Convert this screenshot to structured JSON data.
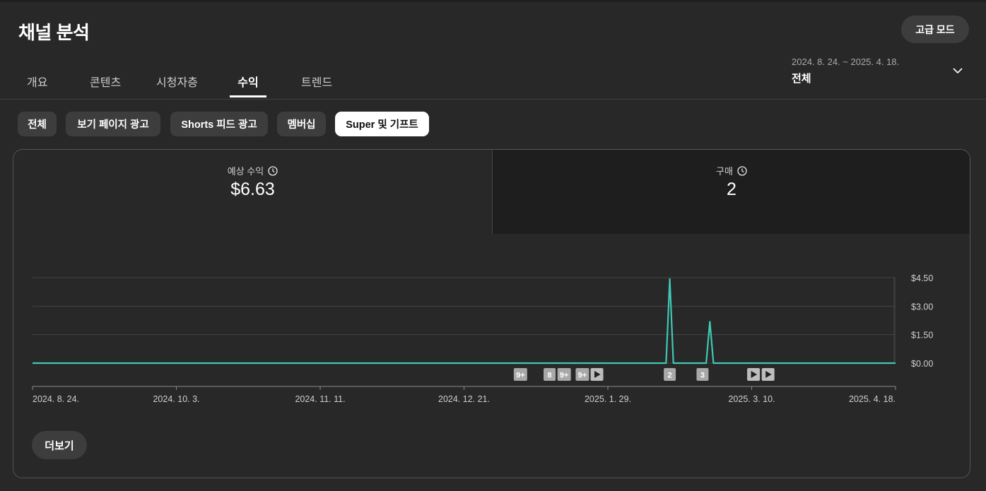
{
  "app": {
    "title": "채널 분석",
    "advanced_mode_label": "고급 모드"
  },
  "tabs": [
    {
      "label": "개요",
      "active": false
    },
    {
      "label": "콘텐츠",
      "active": false
    },
    {
      "label": "시청자층",
      "active": false
    },
    {
      "label": "수익",
      "active": true
    },
    {
      "label": "트렌드",
      "active": false
    }
  ],
  "date_picker": {
    "range": "2024. 8. 24. ~ 2025. 4. 18.",
    "period": "전체",
    "icon": "chevron-down-icon"
  },
  "filter_chips": [
    {
      "label": "전체",
      "selected": false
    },
    {
      "label": "보기 페이지 광고",
      "selected": false
    },
    {
      "label": "Shorts 피드 광고",
      "selected": false
    },
    {
      "label": "멤버십",
      "selected": false
    },
    {
      "label": "Super 및 기프트",
      "selected": true
    }
  ],
  "metrics": [
    {
      "label": "예상 수익",
      "value": "$6.63",
      "icon": "clock-icon",
      "selected": true
    },
    {
      "label": "구매",
      "value": "2",
      "icon": "clock-icon",
      "selected": false
    }
  ],
  "chart_data": {
    "type": "line",
    "title": "",
    "xlabel": "",
    "ylabel": "",
    "x_ticks": [
      "2024. 8. 24.",
      "2024. 10. 3.",
      "2024. 11. 11.",
      "2024. 12. 21.",
      "2025. 1. 29.",
      "2025. 3. 10.",
      "2025. 4. 18."
    ],
    "y_ticks": [
      "$4.50",
      "$3.00",
      "$1.50",
      "$0.00"
    ],
    "ylim": [
      0,
      4.5
    ],
    "xlim": [
      "2024-08-24",
      "2025-04-18"
    ],
    "y_axis_side": "right",
    "grid": true,
    "line_color": "#3ec9b4",
    "series": [
      {
        "points": [
          {
            "x": "2024-08-24",
            "y": 0
          },
          {
            "x": "2025-02-14",
            "y": 0
          },
          {
            "x": "2025-02-15",
            "y": 4.43
          },
          {
            "x": "2025-02-16",
            "y": 0
          },
          {
            "x": "2025-02-25",
            "y": 0
          },
          {
            "x": "2025-02-26",
            "y": 2.18
          },
          {
            "x": "2025-02-27",
            "y": 0
          },
          {
            "x": "2025-04-18",
            "y": 0
          }
        ]
      }
    ],
    "annotations": [
      {
        "date": "2025-01-05",
        "label": "9+",
        "kind": "count"
      },
      {
        "date": "2025-01-13",
        "label": "8",
        "kind": "count"
      },
      {
        "date": "2025-01-17",
        "label": "9+",
        "kind": "count"
      },
      {
        "date": "2025-01-22",
        "label": "9+",
        "kind": "count"
      },
      {
        "date": "2025-01-26",
        "label": "",
        "kind": "video"
      },
      {
        "date": "2025-02-15",
        "label": "2",
        "kind": "count"
      },
      {
        "date": "2025-02-24",
        "label": "3",
        "kind": "count"
      },
      {
        "date": "2025-03-10",
        "label": "",
        "kind": "video"
      },
      {
        "date": "2025-03-14",
        "label": "",
        "kind": "video"
      }
    ]
  },
  "more_button": {
    "label": "더보기"
  }
}
